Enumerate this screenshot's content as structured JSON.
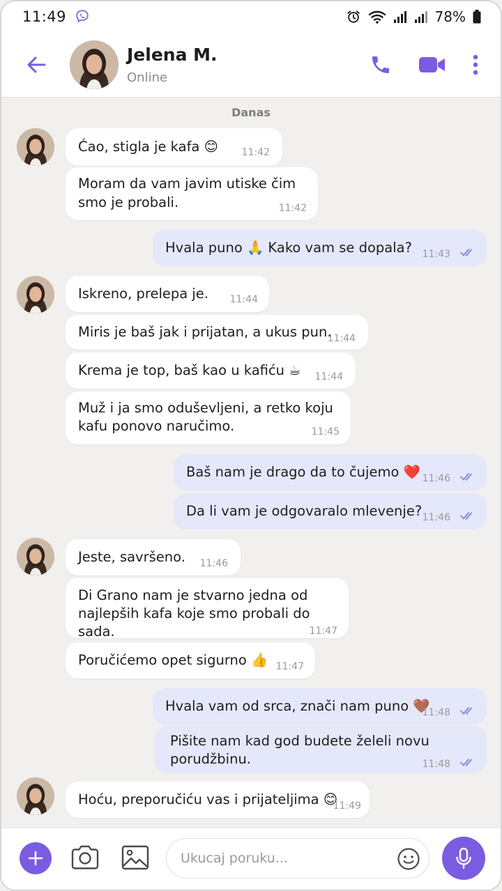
{
  "status_bar": {
    "time": "11:49",
    "battery": "78%"
  },
  "header": {
    "contact_name": "Jelena M.",
    "contact_status": "Online",
    "icons": [
      "back-arrow-icon",
      "phone-icon",
      "video-icon",
      "more-vertical-icon"
    ]
  },
  "chat": {
    "date_label": "Danas",
    "messages": [
      {
        "dir": "in",
        "lines": [
          "Ćao, stigla je kafa 😊"
        ],
        "time": "11:42"
      },
      {
        "dir": "in",
        "lines": [
          "Moram da vam javim utiske čim",
          "smo je probali."
        ],
        "time": "11:42"
      },
      {
        "dir": "out",
        "lines": [
          "Hvala puno 🙏 Kako vam se dopala?"
        ],
        "time": "11:43"
      },
      {
        "dir": "in",
        "lines": [
          "Iskreno, prelepa je."
        ],
        "time": "11:44"
      },
      {
        "dir": "in",
        "lines": [
          "Miris je baš jak i prijatan, a ukus pun."
        ],
        "time": "11:44"
      },
      {
        "dir": "in",
        "lines": [
          "Krema je top, baš kao u kafiću ☕"
        ],
        "time": "11:44"
      },
      {
        "dir": "in",
        "lines": [
          "Muž i ja smo oduševljeni, a retko koju",
          "kafu ponovo naručimo."
        ],
        "time": "11:45"
      },
      {
        "dir": "out",
        "lines": [
          "Baš nam je drago da to čujemo ❤️"
        ],
        "time": "11:46"
      },
      {
        "dir": "out",
        "lines": [
          "Da li vam je odgovaralo mlevenje?"
        ],
        "time": "11:46"
      },
      {
        "dir": "in",
        "lines": [
          "Jeste, savršeno."
        ],
        "time": "11:46"
      },
      {
        "dir": "in",
        "lines": [
          "Di Grano nam je stvarno jedna od",
          "najlepših kafa koje smo probali do sada."
        ],
        "time": "11:47"
      },
      {
        "dir": "in",
        "lines": [
          "Poručićemo opet sigurno 👍"
        ],
        "time": "11:47"
      },
      {
        "dir": "out",
        "lines": [
          "Hvala vam od srca, znači nam puno 🤎"
        ],
        "time": "11:48"
      },
      {
        "dir": "out",
        "lines": [
          "Pišite nam kad god budete želeli novu",
          "porudžbinu."
        ],
        "time": "11:48"
      },
      {
        "dir": "in",
        "lines": [
          "Hoću, preporučiću vas i prijateljima 😊"
        ],
        "time": "11:49"
      }
    ]
  },
  "input_bar": {
    "placeholder": "Ukucaj poruku...",
    "icons": [
      "plus-icon",
      "camera-icon",
      "gallery-icon",
      "emoji-icon",
      "microphone-icon"
    ]
  },
  "colors": {
    "accent": "#7a5ce0",
    "outgoing_bubble": "#e5e7fa",
    "incoming_bubble": "#ffffff",
    "read_check": "#7f86d6"
  }
}
